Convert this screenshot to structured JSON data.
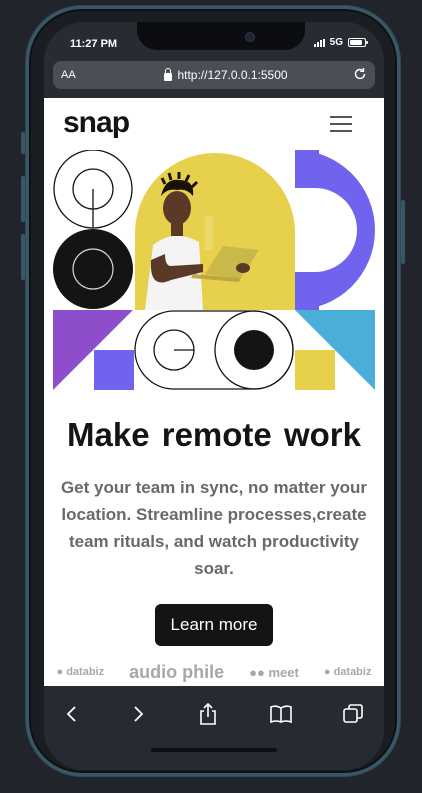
{
  "status": {
    "time": "11:27 PM",
    "network": "5G"
  },
  "browser": {
    "text_size_label": "AA",
    "url": "http://127.0.0.1:5500"
  },
  "site": {
    "logo": "snap",
    "headline": "Make  remote work",
    "description": "Get your team in sync, no matter your location. Streamline processes,create team rituals, and watch productivity soar.",
    "cta_label": "Learn more",
    "clients": [
      "databiz",
      "audio phile",
      "meet",
      "databiz"
    ]
  },
  "colors": {
    "yellow": "#e6d04c",
    "purple": "#7063ee",
    "violet": "#8e4ecb",
    "cyan": "#4aaed9",
    "ink": "#141414"
  },
  "toolbar_icons": [
    "back-icon",
    "forward-icon",
    "share-icon",
    "bookmarks-icon",
    "tabs-icon"
  ]
}
